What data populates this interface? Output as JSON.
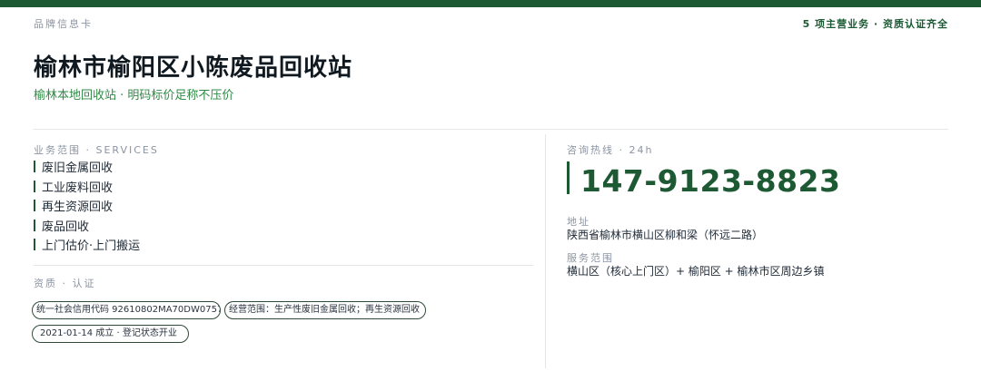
{
  "header": {
    "eyebrow": "品牌信息卡",
    "summary": "5 项主营业务 · 资质认证齐全"
  },
  "brand": {
    "title": "榆林市榆阳区小陈废品回收站",
    "tagline": "榆林本地回收站 · 明码标价足称不压价"
  },
  "services": {
    "label": "业务范围 · SERVICES",
    "items": [
      "废旧金属回收",
      "工业废料回收",
      "再生资源回收",
      "废品回收",
      "上门估价·上门搬运"
    ]
  },
  "qualifications": {
    "label": "资质 · 认证",
    "badges": [
      "统一社会信用代码 92610802MA70DW0757",
      "经营范围：生产性废旧金属回收；再生资源回收",
      "2021-01-14 成立 · 登记状态开业"
    ]
  },
  "contact": {
    "hotline_label": "咨询热线 · 24h",
    "phone": "147-9123-8823",
    "address_label": "地址",
    "address": "陕西省榆林市横山区柳和梁（怀远二路）",
    "area_label": "服务范围",
    "area": "横山区（核心上门区）+ 榆阳区 + 榆林市区周边乡镇"
  },
  "colors": {
    "brand_green": "#1d5a34",
    "accent_green": "#2e8a44"
  }
}
